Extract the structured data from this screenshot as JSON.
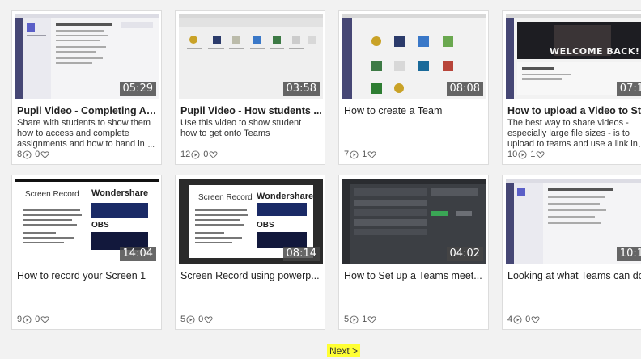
{
  "videos": [
    {
      "title": "Pupil Video - Completing As...",
      "desc": "Share with students to show them how to access and complete assignments and how to hand in",
      "more": "...",
      "duration": "05:29",
      "views": "8",
      "likes": "0"
    },
    {
      "title": "Pupil Video - How students ...",
      "desc": "Use this video to show student how to get onto Teams",
      "more": "",
      "duration": "03:58",
      "views": "12",
      "likes": "0"
    },
    {
      "title": "How to create a Team",
      "desc": "",
      "more": "",
      "duration": "08:08",
      "views": "7",
      "likes": "1"
    },
    {
      "title": "How to upload a Video to St...",
      "desc": "The best way to share videos - especially large file sizes - is to upload to teams and use a link in",
      "more": "...",
      "duration": "07:1",
      "views": "10",
      "likes": "1"
    },
    {
      "title": "How to record your Screen 1",
      "desc": "",
      "more": "",
      "duration": "14:04",
      "views": "9",
      "likes": "0"
    },
    {
      "title": "Screen Record using powerp...",
      "desc": "",
      "more": "",
      "duration": "08:14",
      "views": "5",
      "likes": "0"
    },
    {
      "title": "How to Set up a Teams meet...",
      "desc": "",
      "more": "",
      "duration": "04:02",
      "views": "5",
      "likes": "1"
    },
    {
      "title": "Looking at what Teams can do",
      "desc": "",
      "more": "",
      "duration": "10:1",
      "views": "4",
      "likes": "0"
    }
  ],
  "thumb_text": {
    "welcome": "WELCOME BACK!",
    "screen_record": "Screen Record",
    "wondershare": "Wondershare",
    "obs": "OBS"
  },
  "pager": {
    "next_label": "Next >"
  },
  "colors": {
    "accent": "#5b5fc7",
    "highlight": "#ffff33"
  }
}
